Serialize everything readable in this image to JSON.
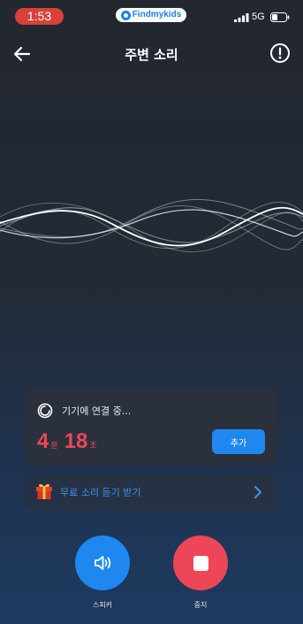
{
  "status_bar": {
    "time": "1:53",
    "app_name": "Findmykids",
    "network": "5G"
  },
  "header": {
    "title": "주변 소리"
  },
  "status_card": {
    "connecting_text": "기기에 연결 중...",
    "timer": {
      "minutes": "4",
      "minutes_unit": "분",
      "seconds": "18",
      "seconds_unit": "초"
    },
    "add_button_label": "추가"
  },
  "free_listen": {
    "label": "무료 소리 듣기 받기"
  },
  "controls": {
    "speaker_label": "스피커",
    "stop_label": "중지"
  },
  "colors": {
    "accent_blue": "#1e88f0",
    "stop_red": "#ee4659",
    "timer_red": "#ef4558",
    "time_pill_red": "#d8403a"
  },
  "icons": {
    "back": "arrow-left-icon",
    "info": "exclamation-circle-icon",
    "connecting": "spinner-ring-icon",
    "gift": "gift-icon",
    "chevron": "chevron-right-icon",
    "speaker": "speaker-icon",
    "stop": "stop-square-icon"
  }
}
